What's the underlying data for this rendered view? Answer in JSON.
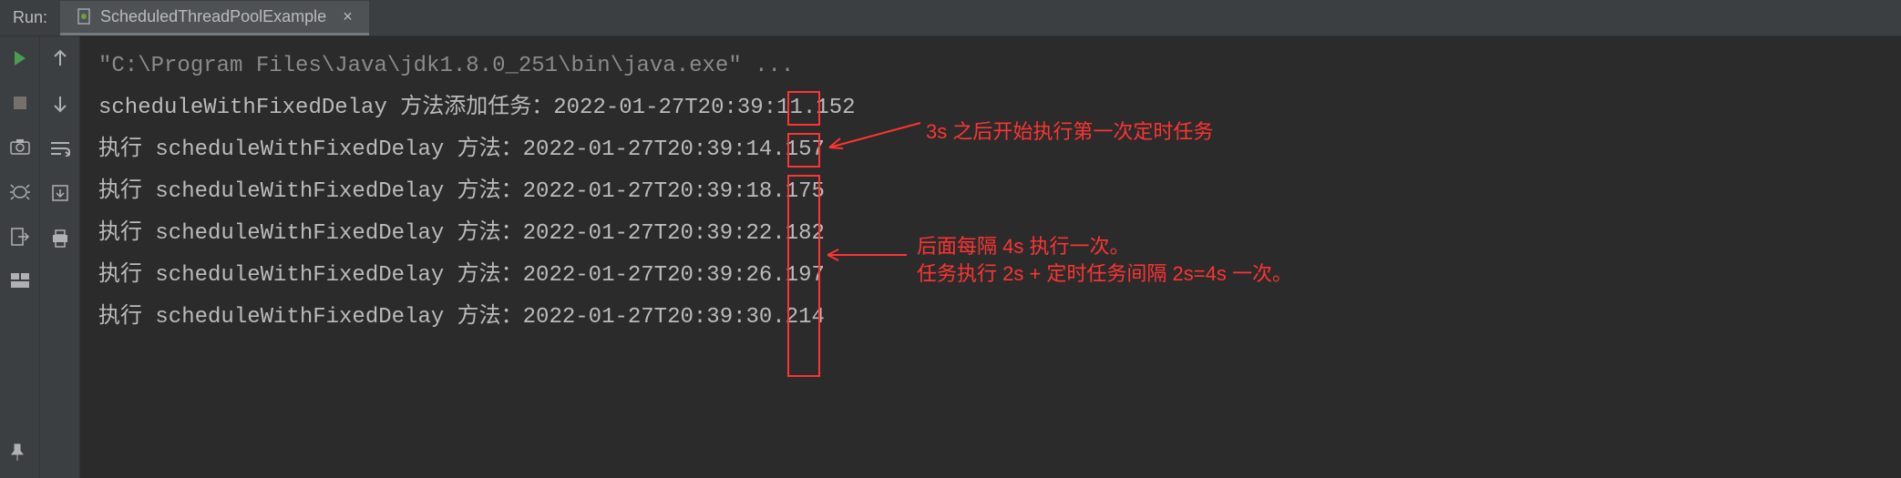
{
  "header": {
    "run_label": "Run:",
    "tab_name": "ScheduledThreadPoolExample"
  },
  "console": {
    "cmd": "\"C:\\Program Files\\Java\\jdk1.8.0_251\\bin\\java.exe\" ...",
    "lines": [
      "scheduleWithFixedDelay 方法添加任务：2022-01-27T20:39:11.152",
      "执行 scheduleWithFixedDelay 方法：2022-01-27T20:39:14.157",
      "执行 scheduleWithFixedDelay 方法：2022-01-27T20:39:18.175",
      "执行 scheduleWithFixedDelay 方法：2022-01-27T20:39:22.182",
      "执行 scheduleWithFixedDelay 方法：2022-01-27T20:39:26.197",
      "执行 scheduleWithFixedDelay 方法：2022-01-27T20:39:30.214"
    ]
  },
  "annotations": {
    "note1": "3s 之后开始执行第一次定时任务",
    "note2_line1": "后面每隔 4s 执行一次。",
    "note2_line2": "任务执行 2s + 定时任务间隔 2s=4s 一次。"
  },
  "icons": {
    "play": "play-icon",
    "stop": "stop-icon",
    "camera": "camera-icon",
    "debug": "debug-icon",
    "exit": "exit-icon",
    "layout": "layout-icon",
    "pin": "pin-icon",
    "up": "up-icon",
    "down": "down-icon",
    "wrap": "wrap-icon",
    "print": "print-icon",
    "file": "file-icon",
    "scroll": "scroll-icon"
  }
}
